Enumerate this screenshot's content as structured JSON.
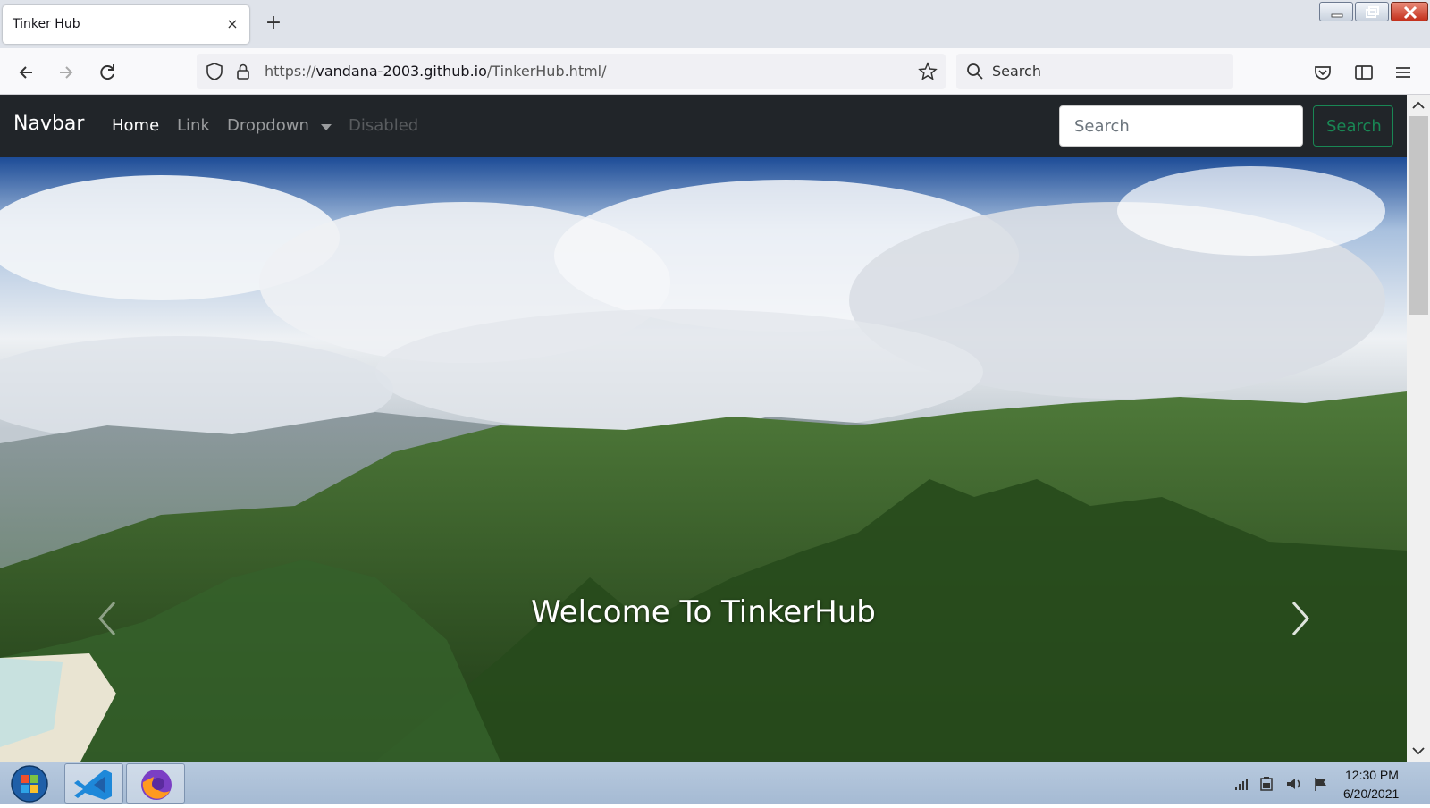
{
  "browser": {
    "tab_title": "Tinker Hub",
    "close_tab_glyph": "×",
    "new_tab_glyph": "+",
    "url_scheme": "https://",
    "url_host": "vandana-2003.github.io",
    "url_path": "/TinkerHub.html/",
    "search_placeholder": "Search",
    "icons": [
      "back-icon",
      "forward-icon",
      "reload-icon",
      "shield-icon",
      "lock-icon",
      "star-icon",
      "search-icon",
      "pocket-icon",
      "sidebar-icon",
      "menu-icon"
    ]
  },
  "site": {
    "brand": "Navbar",
    "nav": {
      "home": "Home",
      "link": "Link",
      "dropdown": "Dropdown",
      "disabled": "Disabled"
    },
    "search": {
      "placeholder": "Search",
      "button": "Search"
    },
    "hero": {
      "caption": "Welcome To TinkerHub"
    },
    "colors": {
      "navbar_bg": "#212529",
      "search_button": "#198754"
    }
  },
  "taskbar": {
    "time": "12:30 PM",
    "date": "6/20/2021",
    "apps": [
      "windows-start",
      "vscode",
      "firefox"
    ]
  }
}
